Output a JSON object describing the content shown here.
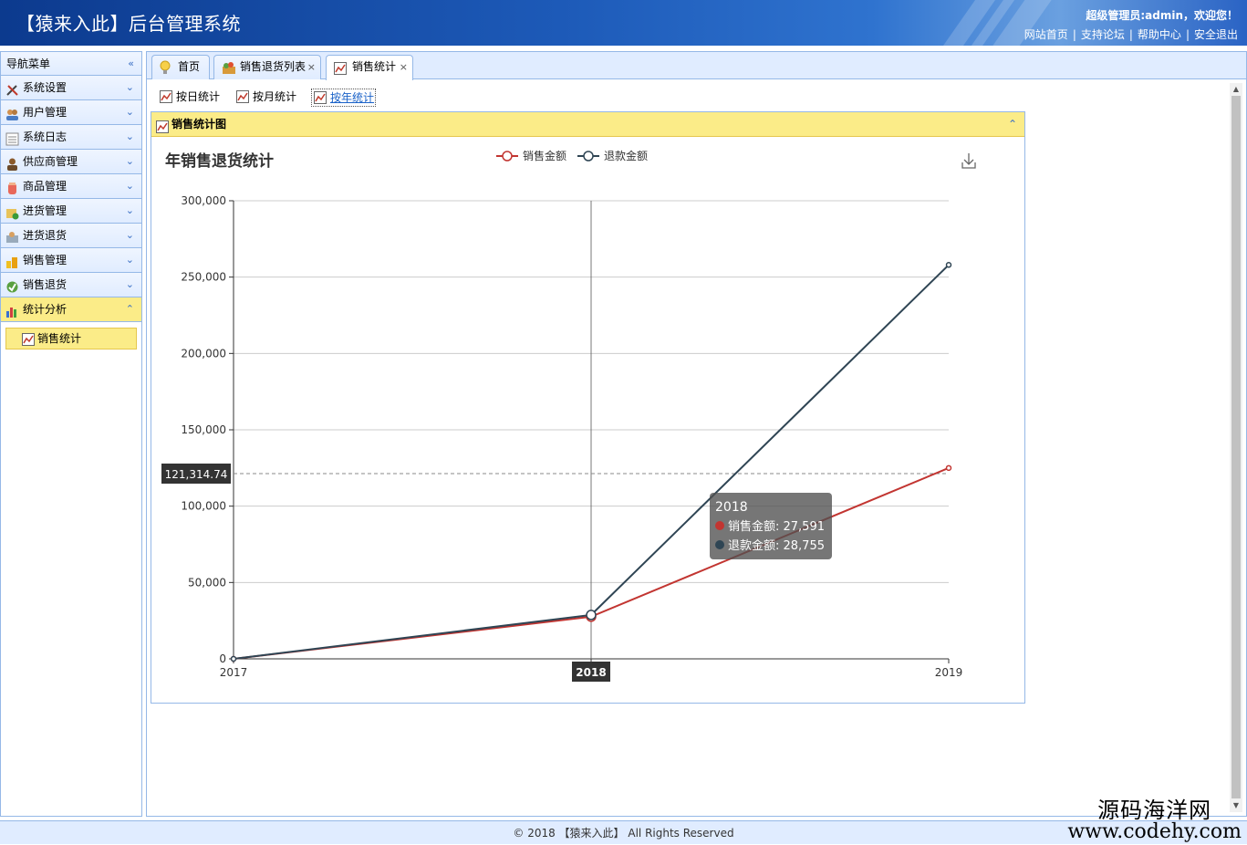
{
  "header": {
    "app_title": "【猿来入此】后台管理系统",
    "welcome": "超级管理员:admin，欢迎您！",
    "links": [
      "网站首页",
      "支持论坛",
      "帮助中心",
      "安全退出"
    ]
  },
  "sidebar": {
    "title": "导航菜单",
    "items": [
      {
        "label": "系统设置",
        "icon": "tools-icon"
      },
      {
        "label": "用户管理",
        "icon": "users-icon"
      },
      {
        "label": "系统日志",
        "icon": "log-icon"
      },
      {
        "label": "供应商管理",
        "icon": "supplier-icon"
      },
      {
        "label": "商品管理",
        "icon": "goods-icon"
      },
      {
        "label": "进货管理",
        "icon": "purchase-icon"
      },
      {
        "label": "进货退货",
        "icon": "purchase-return-icon"
      },
      {
        "label": "销售管理",
        "icon": "sales-icon"
      },
      {
        "label": "销售退货",
        "icon": "sales-return-icon"
      },
      {
        "label": "统计分析",
        "icon": "bar-chart-icon",
        "active": true
      }
    ],
    "sub_item": "销售统计"
  },
  "tabs": [
    {
      "label": "首页",
      "icon": "bulb-icon",
      "closable": false
    },
    {
      "label": "销售退货列表",
      "icon": "basket-icon",
      "closable": true
    },
    {
      "label": "销售统计",
      "icon": "line-chart-icon",
      "closable": true,
      "selected": true
    }
  ],
  "toolbar": {
    "buttons": [
      "按日统计",
      "按月统计",
      "按年统计"
    ],
    "selected": "按年统计"
  },
  "panel": {
    "title": "销售统计图"
  },
  "tooltip": {
    "title": "2018",
    "rows": [
      "销售金额: 27,591",
      "退款金额: 28,755"
    ]
  },
  "axis_pointer": {
    "y_label": "121,314.74",
    "x_label": "2018"
  },
  "chart_data": {
    "type": "line",
    "title": "年销售退货统计",
    "categories": [
      "2017",
      "2018",
      "2019"
    ],
    "series": [
      {
        "name": "销售金额",
        "values": [
          0,
          27591,
          125000
        ],
        "color": "#c23531"
      },
      {
        "name": "退款金额",
        "values": [
          0,
          28755,
          258000
        ],
        "color": "#2f4554"
      }
    ],
    "ylim": [
      0,
      300000
    ],
    "yticks": [
      "0",
      "50,000",
      "100,000",
      "150,000",
      "200,000",
      "250,000",
      "300,000"
    ],
    "grid": true,
    "legend": "top-center"
  },
  "footer": {
    "text": "© 2018 【猿来入此】 All Rights Reserved"
  },
  "watermark": {
    "line1": "源码海洋网",
    "line2": "www.codehy.com"
  }
}
